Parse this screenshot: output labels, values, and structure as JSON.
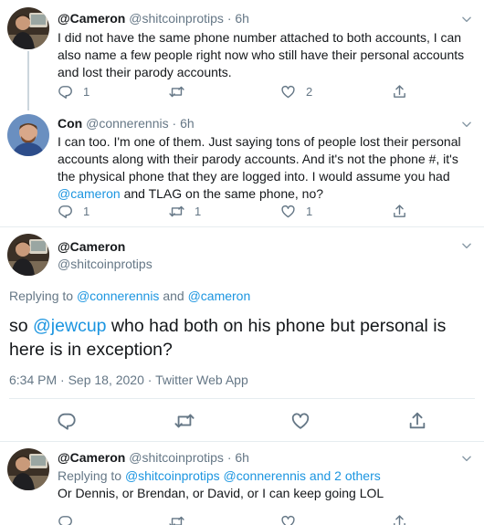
{
  "tweet1": {
    "name": "@Cameron",
    "handle": "@shitcoinprotips",
    "sep": "·",
    "time": "6h",
    "text": "I did not have the same phone number attached to both accounts, I can also name a few people right now who still have their personal accounts and lost their parody accounts.",
    "reply_count": "1",
    "retweet_count": "",
    "like_count": "2"
  },
  "tweet2": {
    "name": "Con",
    "handle": "@connerennis",
    "sep": "·",
    "time": "6h",
    "text_before": "I can too. I'm one of them. Just saying tons of people lost their personal accounts along with their parody accounts. And it's not the phone #, it's the physical phone that they are logged into. I would assume you had ",
    "mention": "@cameron",
    "text_after": " and TLAG on the same phone, no?",
    "reply_count": "1",
    "retweet_count": "1",
    "like_count": "1"
  },
  "main_tweet": {
    "name": "@Cameron",
    "handle": "@shitcoinprotips",
    "replying_prefix": "Replying to ",
    "replying_user1": "@connerennis",
    "replying_and": " and ",
    "replying_user2": "@cameron",
    "text_before": "so ",
    "mention": "@jewcup",
    "text_after": " who had both on his phone but personal is here is in exception?",
    "timestamp": "6:34 PM · Sep 18, 2020 · Twitter Web App"
  },
  "tweet4": {
    "name": "@Cameron",
    "handle": "@shitcoinprotips",
    "sep": "·",
    "time": "6h",
    "replying_prefix": "Replying to ",
    "replying_users": "@shitcoinprotips @connerennis and 2 others",
    "text": "Or Dennis, or Brendan, or David, or I can keep going LOL"
  },
  "colors": {
    "link": "#1b95e0",
    "secondary": "#657786",
    "divider": "#e6ecf0",
    "thread_line": "#ccd6dd"
  },
  "icons": [
    "reply-icon",
    "retweet-icon",
    "like-icon",
    "share-icon",
    "chevron-down-icon"
  ]
}
